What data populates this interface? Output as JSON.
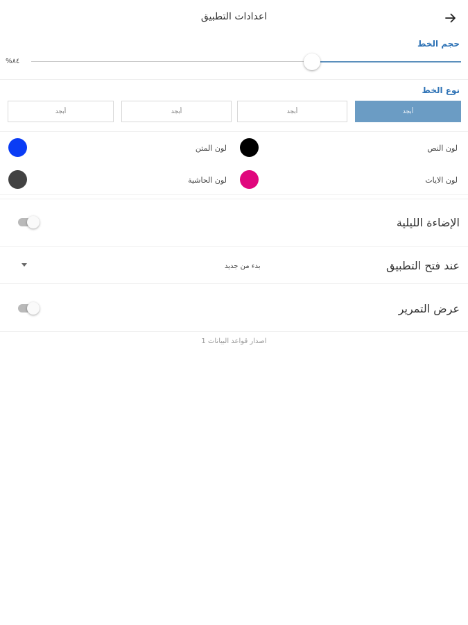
{
  "header": {
    "title": "اعدادات التطبيق",
    "back_icon": "arrow-right-icon"
  },
  "font_size": {
    "label": "حجم الخط",
    "value_text": "%٨٤",
    "value": 84
  },
  "font_type": {
    "label": "نوع الخط",
    "options": [
      "أبجد",
      "أبجد",
      "أبجد",
      "أبجد"
    ],
    "selected_index": 0
  },
  "colors": {
    "text_color_label": "لون النص",
    "text_color": "#000000",
    "body_color_label": "لون المتن",
    "body_color": "#0a3cf5",
    "verses_color_label": "لون الايات",
    "verses_color": "#e0077d",
    "margin_color_label": "لون الحاشية",
    "margin_color": "#424242"
  },
  "settings": {
    "night_mode_label": "الإضاءة الليلية",
    "night_mode_on": false,
    "on_open_label": "عند فتح التطبيق",
    "on_open_value": "بدء من جديد",
    "scroll_view_label": "عرض التمرير",
    "scroll_view_on": false
  },
  "footer": {
    "db_version": "اصدار قواعد البيانات 1"
  },
  "theme": {
    "accent": "#2f73b6",
    "active_button": "#6b9cc4"
  }
}
